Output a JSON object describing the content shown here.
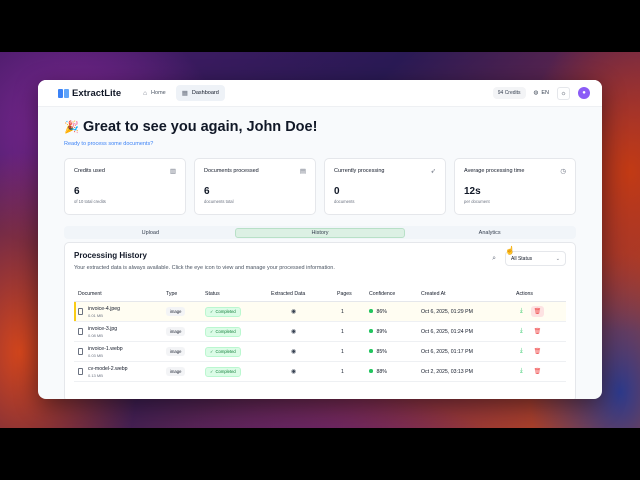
{
  "app": {
    "logo_text": "ExtractLite",
    "nav": [
      {
        "label": "Home",
        "icon": "home-icon",
        "active": false
      },
      {
        "label": "Dashboard",
        "icon": "grid-icon",
        "active": true
      }
    ],
    "credits_pill": "94 Credits",
    "language": "EN",
    "theme_icon": "sun-icon"
  },
  "hero": {
    "greeting": "Great to see you again, John Doe!",
    "subtitle": "Ready to process some documents?"
  },
  "stats": [
    {
      "title": "Credits used",
      "value": "6",
      "caption": "of 10 total credits",
      "icon": "chart-icon"
    },
    {
      "title": "Documents processed",
      "value": "6",
      "caption": "documents total",
      "icon": "document-icon"
    },
    {
      "title": "Currently processing",
      "value": "0",
      "caption": "documents",
      "icon": "rocket-icon"
    },
    {
      "title": "Average processing time",
      "value": "12s",
      "caption": "per document",
      "icon": "clock-icon"
    }
  ],
  "tabs": [
    {
      "label": "Upload",
      "active": false
    },
    {
      "label": "History",
      "active": true
    },
    {
      "label": "Analytics",
      "active": false
    }
  ],
  "history": {
    "title": "Processing History",
    "description": "Your extracted data is always available. Click the eye icon to view and manage your processed information.",
    "status_filter": "All Status",
    "columns": [
      "Document",
      "Type",
      "Status",
      "Extracted Data",
      "Pages",
      "Confidence",
      "Created At",
      "Actions"
    ],
    "rows": [
      {
        "name": "invoice-4.jpeg",
        "size": "0.01 MB",
        "type": "image",
        "status": "Completed",
        "pages": "1",
        "confidence": "86%",
        "created": "Oct 6, 2025, 01:29 PM"
      },
      {
        "name": "invoice-3.jpg",
        "size": "0.08 MB",
        "type": "image",
        "status": "Completed",
        "pages": "1",
        "confidence": "89%",
        "created": "Oct 6, 2025, 01:24 PM"
      },
      {
        "name": "invoice-1.webp",
        "size": "0.03 MB",
        "type": "image",
        "status": "Completed",
        "pages": "1",
        "confidence": "85%",
        "created": "Oct 6, 2025, 01:17 PM"
      },
      {
        "name": "cv-model-2.webp",
        "size": "0.13 MB",
        "type": "image",
        "status": "Completed",
        "pages": "1",
        "confidence": "88%",
        "created": "Oct 2, 2025, 03:13 PM"
      }
    ]
  },
  "colors": {
    "accent": "#3b82f6",
    "success": "#22c55e",
    "danger": "#ef4444",
    "avatar": "#8b5cf6"
  }
}
